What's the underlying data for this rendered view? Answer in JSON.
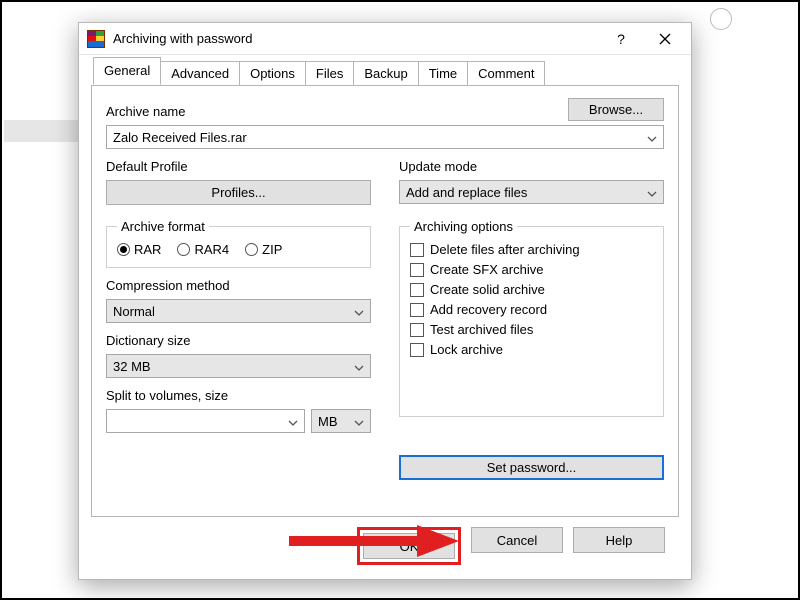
{
  "window": {
    "title": "Archiving with password"
  },
  "tabs": [
    "General",
    "Advanced",
    "Options",
    "Files",
    "Backup",
    "Time",
    "Comment"
  ],
  "active_tab": "General",
  "general": {
    "archive_name_label": "Archive name",
    "browse_label": "Browse...",
    "archive_name_value": "Zalo Received Files.rar",
    "default_profile_label": "Default Profile",
    "profiles_btn": "Profiles...",
    "update_mode_label": "Update mode",
    "update_mode_value": "Add and replace files",
    "archive_format_label": "Archive format",
    "format_options": {
      "rar": "RAR",
      "rar4": "RAR4",
      "zip": "ZIP"
    },
    "format_selected": "RAR",
    "compression_label": "Compression method",
    "compression_value": "Normal",
    "dict_label": "Dictionary size",
    "dict_value": "32 MB",
    "split_label": "Split to volumes, size",
    "split_value": "",
    "split_unit": "MB",
    "archiving_options_label": "Archiving options",
    "opts": {
      "delete": "Delete files after archiving",
      "sfx": "Create SFX archive",
      "solid": "Create solid archive",
      "recovery": "Add recovery record",
      "test": "Test archived files",
      "lock": "Lock archive"
    },
    "set_password_label": "Set password..."
  },
  "footer": {
    "ok": "OK",
    "cancel": "Cancel",
    "help": "Help"
  }
}
